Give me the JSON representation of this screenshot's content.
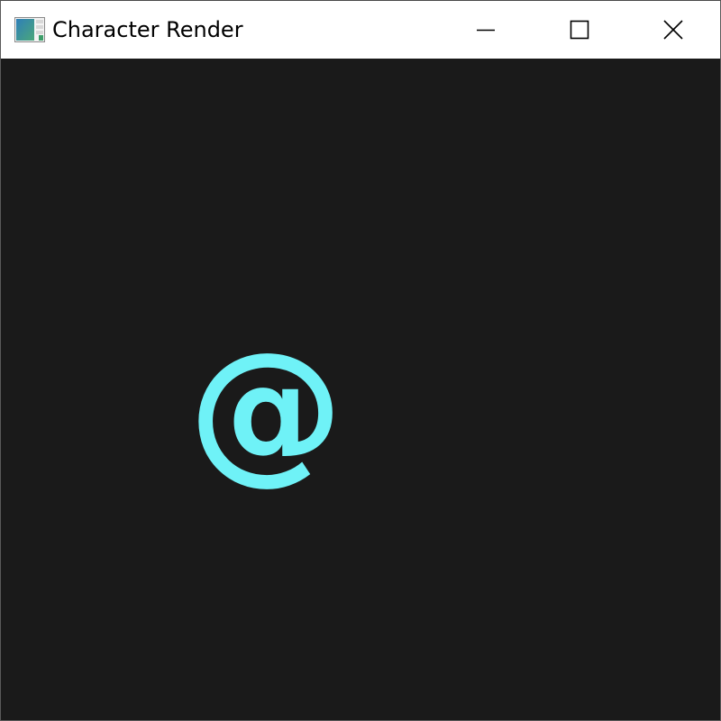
{
  "window": {
    "title": "Character Render",
    "app_icon": "app-window-icon",
    "controls": {
      "minimize_icon": "minimize-icon",
      "maximize_icon": "maximize-icon",
      "close_icon": "close-icon"
    }
  },
  "canvas": {
    "background_color": "#1a1a1a",
    "character": "@",
    "character_color": "#6ff2f7"
  }
}
